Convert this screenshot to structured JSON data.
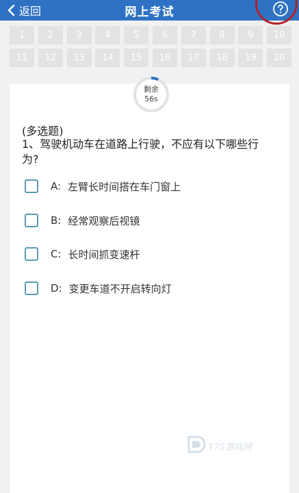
{
  "header": {
    "back_label": "返回",
    "title": "网上考试"
  },
  "question_grid": {
    "numbers": [
      "1",
      "2",
      "3",
      "4",
      "5",
      "6",
      "7",
      "8",
      "9",
      "10",
      "11",
      "12",
      "13",
      "14",
      "15",
      "16",
      "17",
      "18",
      "19",
      "20"
    ]
  },
  "timer": {
    "label": "剩余",
    "value": "56s",
    "remaining_fraction": 0.07
  },
  "question": {
    "type": "(多选题)",
    "text": "1、驾驶机动车在道路上行驶，不应有以下哪些行为?",
    "options": [
      {
        "letter": "A:",
        "text": "左臂长时间搭在车门窗上"
      },
      {
        "letter": "B:",
        "text": "经常观察后视镜"
      },
      {
        "letter": "C:",
        "text": "长时间抓变速杆"
      },
      {
        "letter": "D:",
        "text": "变更车道不开启转向灯"
      }
    ]
  },
  "watermark": {
    "text": "175游戏网"
  },
  "colors": {
    "header": "#2f72c4",
    "annotation_circle": "#b3232a",
    "timer_progress": "#2f72c4",
    "checkbox_border": "#5a9bb0"
  }
}
